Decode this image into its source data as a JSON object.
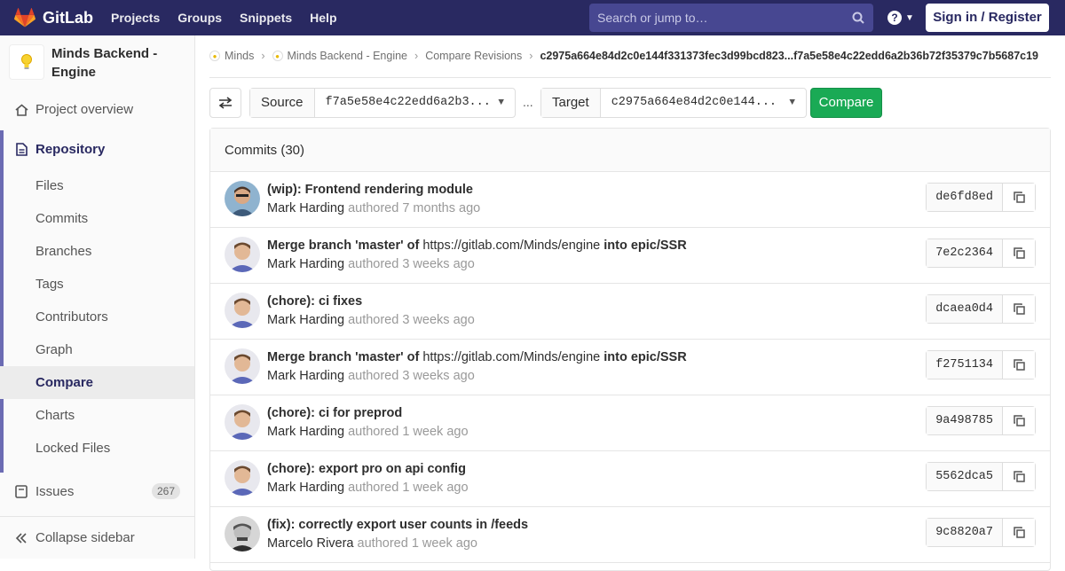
{
  "navbar": {
    "brand": "GitLab",
    "links": [
      "Projects",
      "Groups",
      "Snippets",
      "Help"
    ],
    "search_placeholder": "Search or jump to…",
    "signin_label": "Sign in / Register"
  },
  "sidebar": {
    "project_name": "Minds Backend - Engine",
    "overview_label": "Project overview",
    "repository_label": "Repository",
    "repo_items": [
      "Files",
      "Commits",
      "Branches",
      "Tags",
      "Contributors",
      "Graph",
      "Compare",
      "Charts",
      "Locked Files"
    ],
    "active_item": "Compare",
    "issues_label": "Issues",
    "issues_count": "267",
    "collapse_label": "Collapse sidebar"
  },
  "breadcrumb": {
    "items": [
      "Minds",
      "Minds Backend - Engine",
      "Compare Revisions"
    ],
    "current": "c2975a664e84d2c0e144f331373fec3d99bcd823...f7a5e58e4c22edd6a2b36b72f35379c7b5687c19"
  },
  "compare": {
    "source_label": "Source",
    "source_value": "f7a5e58e4c22edd6a2b3...",
    "dots": "...",
    "target_label": "Target",
    "target_value": "c2975a664e84d2c0e144...",
    "compare_label": "Compare"
  },
  "commits": {
    "header": "Commits (30)",
    "verb": "authored",
    "items": [
      {
        "title": "(wip): Frontend rendering module",
        "author": "Mark Harding",
        "time": "7 months ago",
        "sha": "de6fd8ed"
      },
      {
        "title_pre": "Merge branch 'master' of",
        "title_link": "https://gitlab.com/Minds/engine",
        "title_post": "into epic/SSR",
        "author": "Mark Harding",
        "time": "3 weeks ago",
        "sha": "7e2c2364"
      },
      {
        "title": "(chore): ci fixes",
        "author": "Mark Harding",
        "time": "3 weeks ago",
        "sha": "dcaea0d4"
      },
      {
        "title_pre": "Merge branch 'master' of",
        "title_link": "https://gitlab.com/Minds/engine",
        "title_post": "into epic/SSR",
        "author": "Mark Harding",
        "time": "3 weeks ago",
        "sha": "f2751134"
      },
      {
        "title": "(chore): ci for preprod",
        "author": "Mark Harding",
        "time": "1 week ago",
        "sha": "9a498785"
      },
      {
        "title": "(chore): export pro on api config",
        "author": "Mark Harding",
        "time": "1 week ago",
        "sha": "5562dca5"
      },
      {
        "title": "(fix): correctly export user counts in /feeds",
        "author": "Marcelo Rivera",
        "time": "1 week ago",
        "sha": "9c8820a7"
      }
    ]
  },
  "colors": {
    "navbar": "#292961",
    "accent": "#6b6bb3",
    "compare_button": "#1aaa55"
  }
}
